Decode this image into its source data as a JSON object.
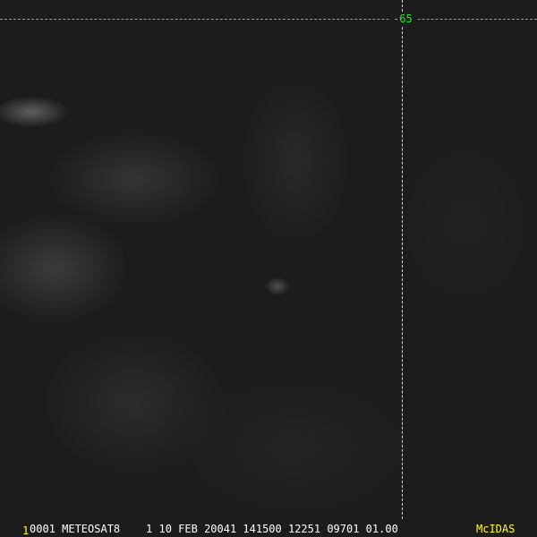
{
  "image": {
    "contour_label": "-65",
    "colors": {
      "latitude_line": "#00d8e8",
      "longitude_line": "#d8d8d8",
      "label": "#22ee22",
      "logo": "#ffff20"
    }
  },
  "footer": {
    "frame_number": "1",
    "info": "0001 METEOSAT8    1 10 FEB 20041 141500 12251 09701 01.00",
    "logo": "McIDAS"
  }
}
